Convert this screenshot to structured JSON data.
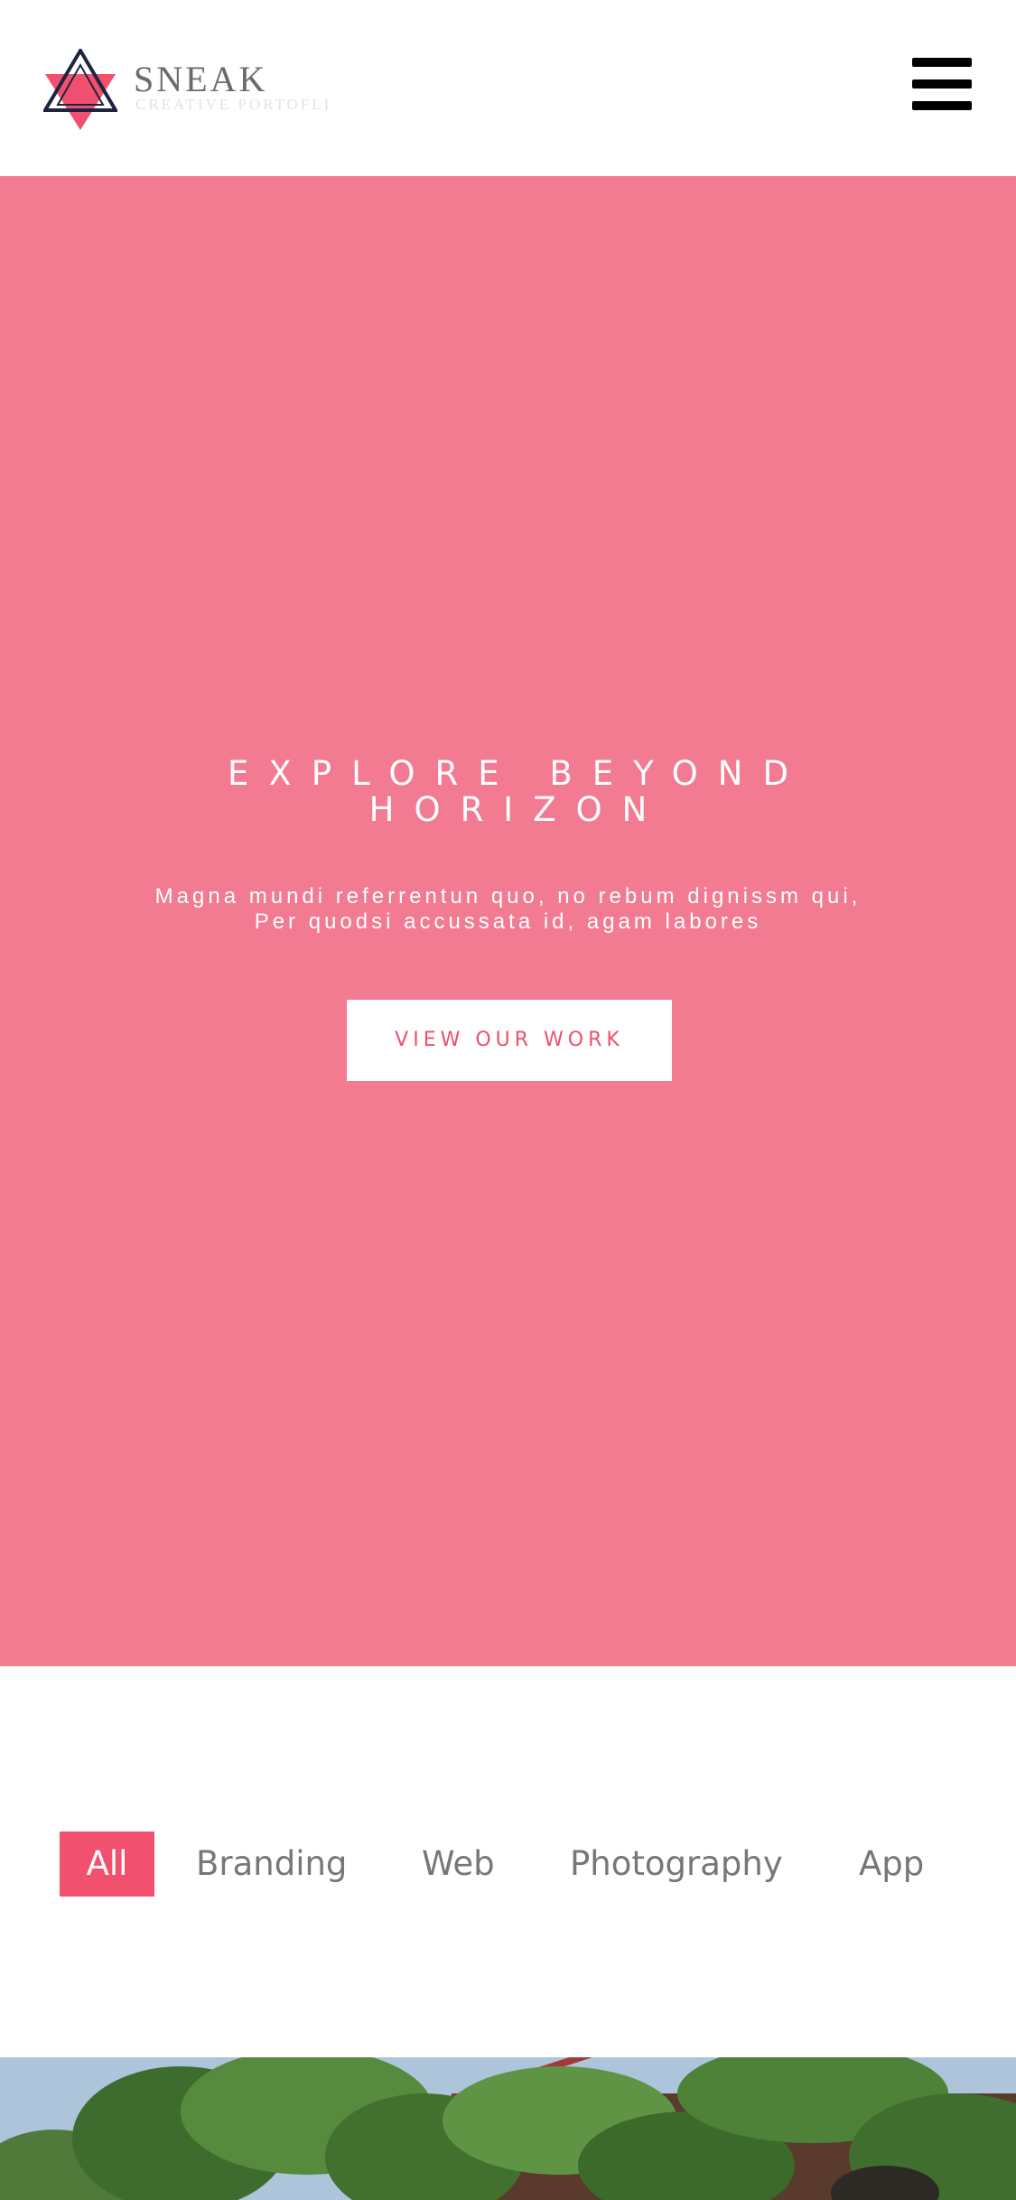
{
  "header": {
    "brand_name": "SNEAK",
    "brand_tagline": "CREATIVE PORTOFLI",
    "logo_icon": "hexagram-logo-icon",
    "menu_icon": "hamburger-menu-icon"
  },
  "hero": {
    "title_line1": "EXPLORE BEYOND",
    "title_line2": "HORIZON",
    "subtitle_line1": "Magna mundi referrentun quo, no rebum dignissm qui,",
    "subtitle_line2": "Per quodsi accussata id, agam labores",
    "cta_label": "VIEW OUR WORK",
    "background_color": "#f27b92"
  },
  "filters": {
    "items": [
      {
        "label": "All",
        "active": true
      },
      {
        "label": "Branding",
        "active": false
      },
      {
        "label": "Web",
        "active": false
      },
      {
        "label": "Photography",
        "active": false
      },
      {
        "label": "App",
        "active": false
      }
    ],
    "accent_color": "#f2506f"
  },
  "gallery": {
    "first_item": "ivy-covered-building-photo"
  }
}
